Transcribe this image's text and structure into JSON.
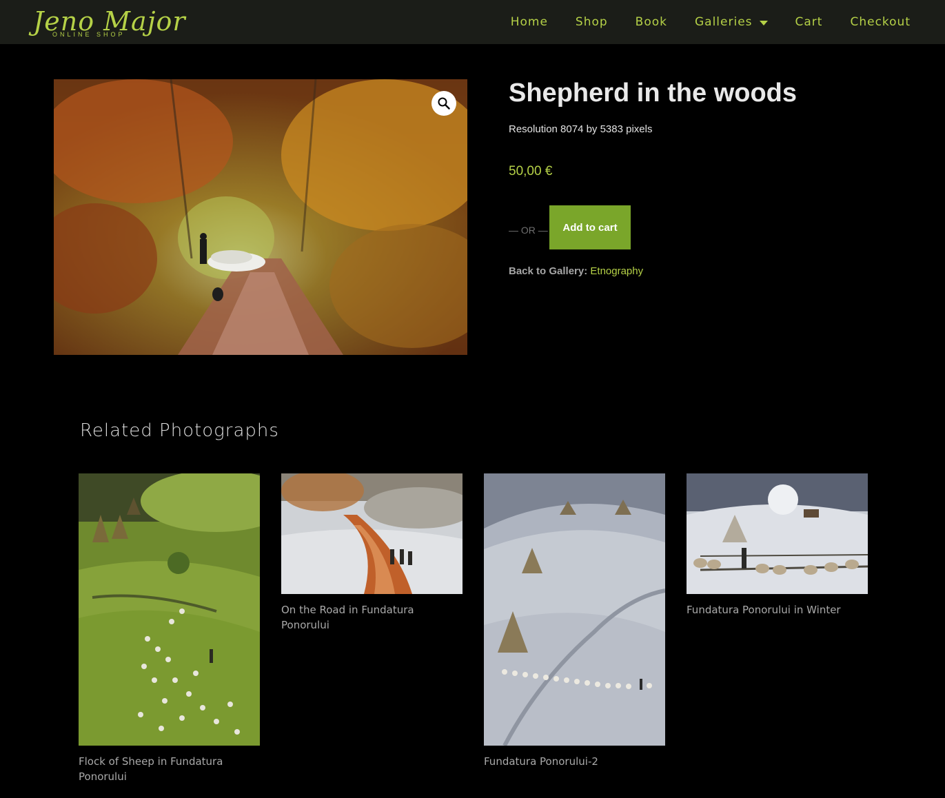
{
  "header": {
    "logo_text": "Jeno Major",
    "logo_sub": "ONLINE SHOP",
    "nav": [
      {
        "label": "Home"
      },
      {
        "label": "Shop"
      },
      {
        "label": "Book"
      },
      {
        "label": "Galleries"
      },
      {
        "label": "Cart"
      },
      {
        "label": "Checkout"
      }
    ],
    "accent_color": "#b5d147"
  },
  "product": {
    "title": "Shepherd in the woods",
    "resolution": "Resolution 8074 by 5383 pixels",
    "price": "50,00 €",
    "or_text": "— OR —",
    "add_to_cart_label": "Add to cart",
    "add_to_cart_color": "#7aa62a",
    "back_label": "Back to Gallery:",
    "back_link": "Etnography",
    "zoom_icon": "search-icon"
  },
  "related": {
    "title": "Related Photographs",
    "items": [
      {
        "caption": "Flock of Sheep in Fundatura Ponorului"
      },
      {
        "caption": "On the Road in Fundatura Ponorului"
      },
      {
        "caption": "Fundatura Ponorului-2"
      },
      {
        "caption": "Fundatura Ponorului in Winter"
      }
    ]
  }
}
